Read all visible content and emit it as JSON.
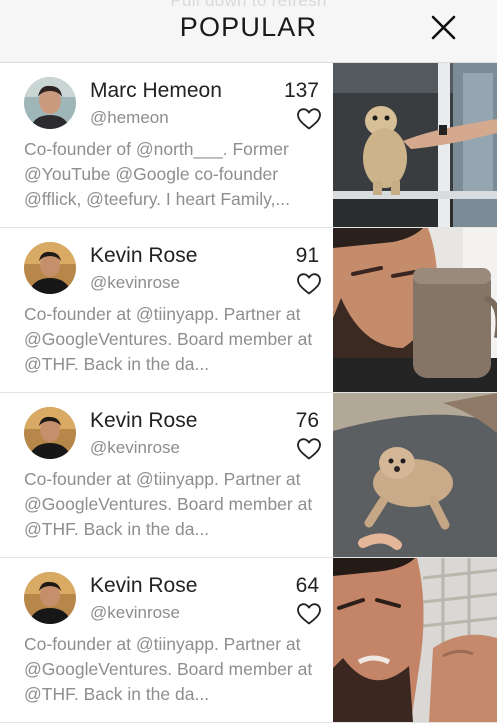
{
  "header": {
    "pull_hint": "Pull down to refresh",
    "title": "POPULAR",
    "close_icon": "close-icon"
  },
  "feed": [
    {
      "name": "Marc Hemeon",
      "handle": "@hemeon",
      "likes": "137",
      "bio": "Co-founder of @north___. Former @YouTube @Google co-founder @fflick, @teefury. I heart Family,...",
      "thumbnail": "dog-at-sliding-door"
    },
    {
      "name": "Kevin Rose",
      "handle": "@kevinrose",
      "likes": "91",
      "bio": "Co-founder at @tiinyapp. Partner at @GoogleVentures. Board member at @THF. Back in the da...",
      "thumbnail": "man-drinking-from-mug"
    },
    {
      "name": "Kevin Rose",
      "handle": "@kevinrose",
      "likes": "76",
      "bio": "Co-founder at @tiinyapp. Partner at @GoogleVentures. Board member at @THF. Back in the da...",
      "thumbnail": "dog-lying-on-floor"
    },
    {
      "name": "Kevin Rose",
      "handle": "@kevinrose",
      "likes": "64",
      "bio": "Co-founder at @tiinyapp. Partner at @GoogleVentures. Board member at @THF. Back in the da...",
      "thumbnail": "man-making-face"
    }
  ],
  "colors": {
    "header_bg": "#f6f6f6",
    "text_primary": "#222222",
    "text_secondary": "#8e8e8e",
    "divider": "#e4e4e4"
  }
}
